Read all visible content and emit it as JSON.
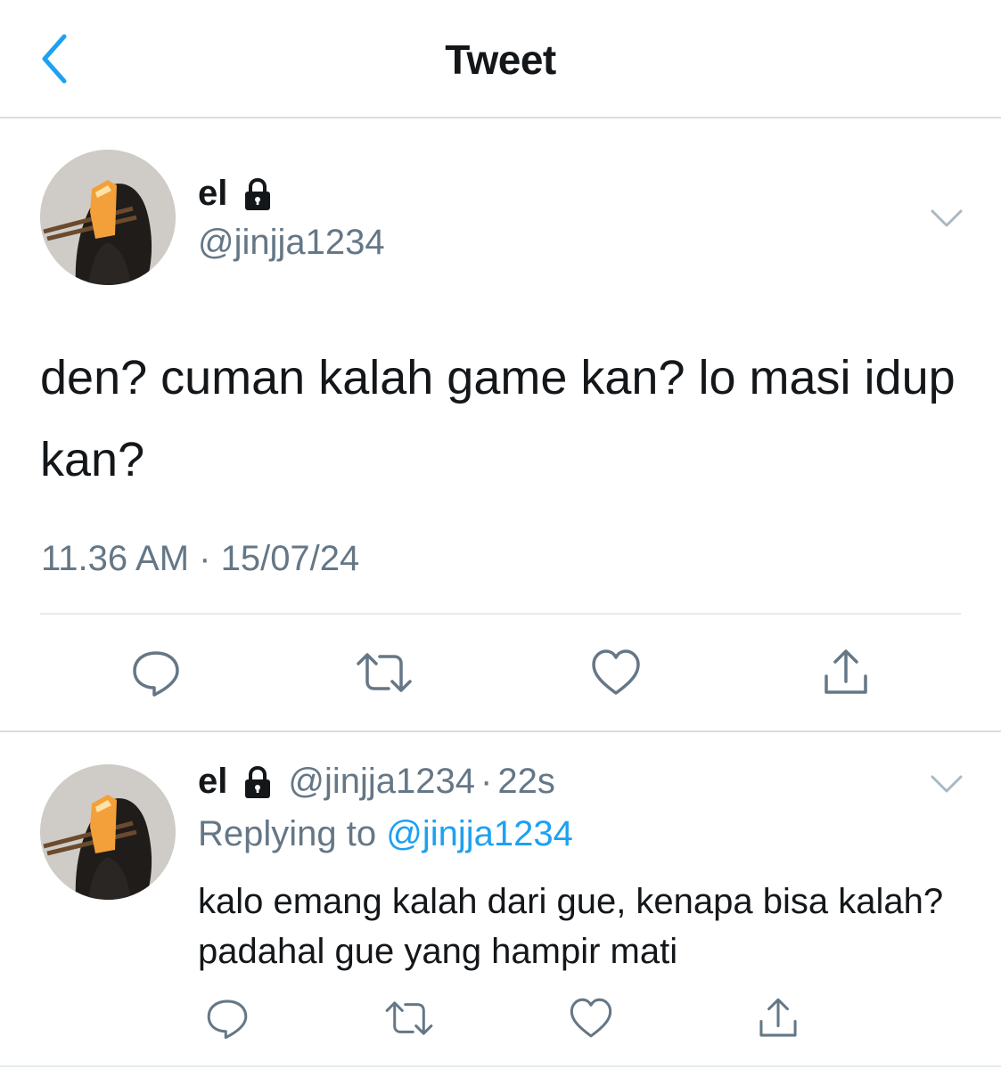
{
  "header": {
    "title": "Tweet"
  },
  "main_tweet": {
    "author_name": "el",
    "author_handle": "@jinjja1234",
    "text": "den? cuman kalah game kan? lo masi idup kan?",
    "timestamp": "11.36 AM · 15/07/24"
  },
  "reply_tweet": {
    "author_name": "el",
    "author_handle": "@jinjja1234",
    "separator": "·",
    "time_ago": "22s",
    "replying_prefix": "Replying to",
    "replying_to": "@jinjja1234",
    "text": "kalo emang kalah dari gue, kenapa bisa kalah? padahal gue yang hampir mati"
  },
  "icons": {
    "back": "chevron-left-icon",
    "lock": "lock-icon",
    "menu": "chevron-down-icon",
    "reply": "comment-icon",
    "retweet": "retweet-icon",
    "like": "heart-icon",
    "share": "share-icon"
  },
  "colors": {
    "accent": "#1da1f2",
    "text_primary": "#14171a",
    "text_secondary": "#657786",
    "divider": "#e6ecf0"
  }
}
